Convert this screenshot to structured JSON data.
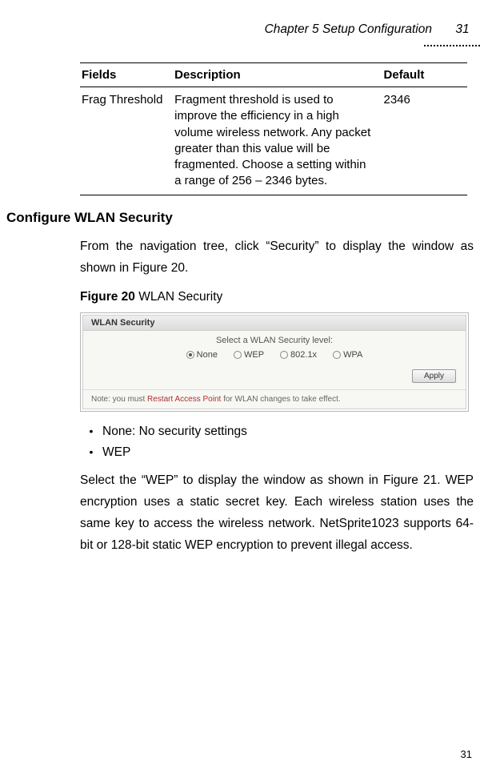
{
  "header": {
    "chapter": "Chapter 5 Setup Configuration",
    "page_top": "31"
  },
  "table": {
    "headers": {
      "field": "Fields",
      "description": "Description",
      "default": "Default"
    },
    "rows": [
      {
        "field": "Frag Threshold",
        "description": "Fragment threshold is used to improve the efficiency in a high volume wireless network. Any packet greater than this value will be fragmented. Choose a setting within a range of 256 – 2346 bytes.",
        "default": "2346"
      }
    ]
  },
  "section_title": "Configure WLAN Security",
  "intro": "From the navigation tree, click “Security” to display the window as shown in Figure 20.",
  "figure": {
    "label_bold": "Figure 20",
    "label_rest": " WLAN Security",
    "panel_title": "WLAN Security",
    "select_label": "Select a WLAN Security level:",
    "options": [
      {
        "label": "None",
        "checked": true
      },
      {
        "label": "WEP",
        "checked": false
      },
      {
        "label": "802.1x",
        "checked": false
      },
      {
        "label": "WPA",
        "checked": false
      }
    ],
    "apply": "Apply",
    "note_prefix": "Note: you must ",
    "note_red": "Restart Access Point",
    "note_suffix": " for WLAN changes to take effect."
  },
  "bullets": [
    "None: No security settings",
    "WEP"
  ],
  "wep_para": "Select the “WEP” to display the window as shown in Figure 21. WEP encryption uses a static secret key. Each wireless station uses the same key to access the wireless network. NetSprite1023 supports 64-bit or 128-bit static WEP encryption to prevent illegal access.",
  "footer_page": "31"
}
